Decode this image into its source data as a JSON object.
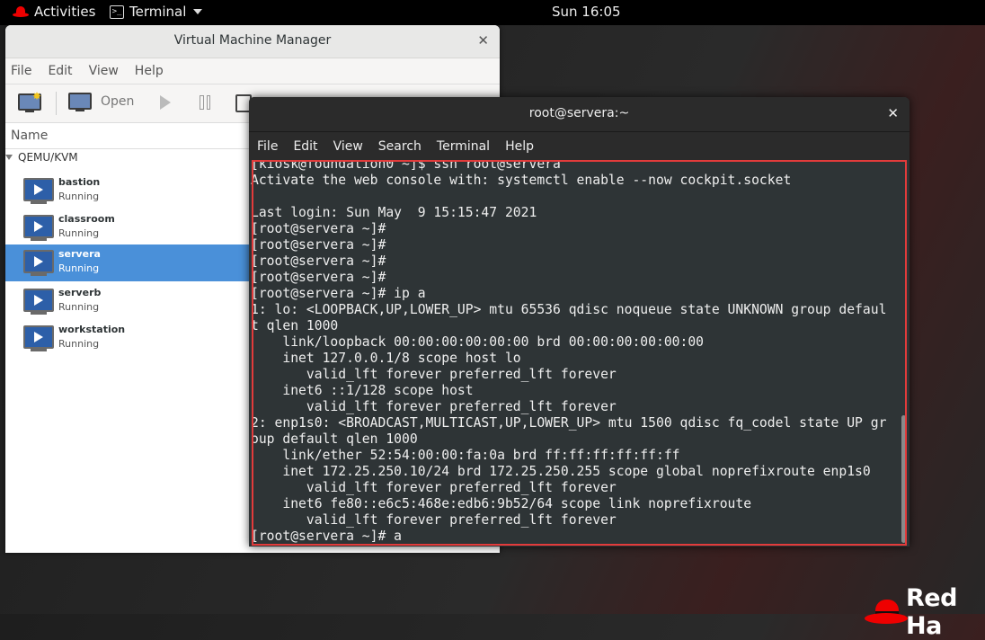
{
  "topbar": {
    "activities": "Activities",
    "app_name": "Terminal",
    "clock": "Sun 16:05"
  },
  "vmm": {
    "title": "Virtual Machine Manager",
    "menu": [
      "File",
      "Edit",
      "View",
      "Help"
    ],
    "toolbar": {
      "open_label": "Open"
    },
    "list_header": "Name",
    "group": "QEMU/KVM",
    "vms": [
      {
        "name": "bastion",
        "status": "Running"
      },
      {
        "name": "classroom",
        "status": "Running"
      },
      {
        "name": "servera",
        "status": "Running",
        "selected": true
      },
      {
        "name": "serverb",
        "status": "Running"
      },
      {
        "name": "workstation",
        "status": "Running"
      }
    ]
  },
  "terminal": {
    "title": "root@servera:~",
    "menu": [
      "File",
      "Edit",
      "View",
      "Search",
      "Terminal",
      "Help"
    ],
    "output": "[kiosk@foundation0 ~]$ ssh root@servera\nActivate the web console with: systemctl enable --now cockpit.socket\n\nLast login: Sun May  9 15:15:47 2021\n[root@servera ~]#\n[root@servera ~]#\n[root@servera ~]#\n[root@servera ~]#\n[root@servera ~]# ip a\n1: lo: <LOOPBACK,UP,LOWER_UP> mtu 65536 qdisc noqueue state UNKNOWN group defaul\nt qlen 1000\n    link/loopback 00:00:00:00:00:00 brd 00:00:00:00:00:00\n    inet 127.0.0.1/8 scope host lo\n       valid_lft forever preferred_lft forever\n    inet6 ::1/128 scope host\n       valid_lft forever preferred_lft forever\n2: enp1s0: <BROADCAST,MULTICAST,UP,LOWER_UP> mtu 1500 qdisc fq_codel state UP gr\noup default qlen 1000\n    link/ether 52:54:00:00:fa:0a brd ff:ff:ff:ff:ff:ff\n    inet 172.25.250.10/24 brd 172.25.250.255 scope global noprefixroute enp1s0\n       valid_lft forever preferred_lft forever\n    inet6 fe80::e6c5:468e:edb6:9b52/64 scope link noprefixroute\n       valid_lft forever preferred_lft forever\n[root@servera ~]# a"
  },
  "brand": {
    "logo_text": "Red Ha"
  },
  "colors": {
    "accent_red": "#e00000",
    "selection_blue": "#4a90d9",
    "terminal_bg": "#2e3436"
  }
}
